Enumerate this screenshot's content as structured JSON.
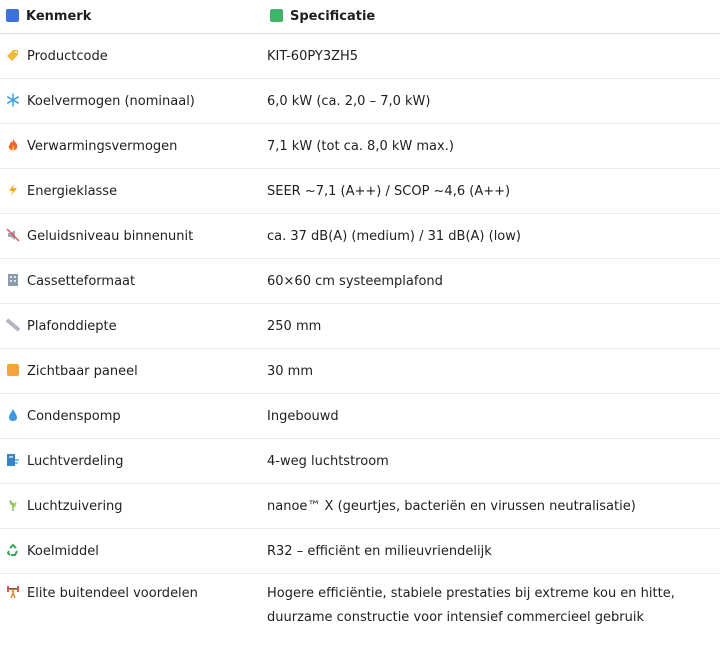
{
  "header": {
    "col1": "Kenmerk",
    "col1_icon": "blue-square-icon",
    "col1_color": "#3b73d9",
    "col2": "Specificatie",
    "col2_icon": "green-square-icon",
    "col2_color": "#3fb56a"
  },
  "rows": [
    {
      "icon": "tag-icon",
      "label": "Productcode",
      "value": "KIT-60PY3ZH5"
    },
    {
      "icon": "snowflake-icon",
      "label": "Koelvermogen (nominaal)",
      "value": "6,0 kW (ca. 2,0 – 7,0 kW)"
    },
    {
      "icon": "fire-icon",
      "label": "Verwarmingsvermogen",
      "value": "7,1 kW (tot ca. 8,0 kW max.)"
    },
    {
      "icon": "lightning-icon",
      "label": "Energieklasse",
      "value": "SEER ~7,1 (A++) / SCOP ~4,6 (A++)"
    },
    {
      "icon": "muted-speaker-icon",
      "label": "Geluidsniveau binnenunit",
      "value": "ca. 37 dB(A) (medium) / 31 dB(A) (low)"
    },
    {
      "icon": "building-icon",
      "label": "Cassetteformaat",
      "value": "60×60 cm systeemplafond"
    },
    {
      "icon": "ruler-icon",
      "label": "Plafonddiepte",
      "value": "250 mm"
    },
    {
      "icon": "orange-square-icon",
      "label": "Zichtbaar paneel",
      "value": "30 mm"
    },
    {
      "icon": "droplet-icon",
      "label": "Condenspomp",
      "value": "Ingebouwd"
    },
    {
      "icon": "wind-building-icon",
      "label": "Luchtverdeling",
      "value": "4-weg luchtstroom"
    },
    {
      "icon": "herb-icon",
      "label": "Luchtzuivering",
      "value": "nanoe™ X (geurtjes, bacteriën en virussen neutralisatie)"
    },
    {
      "icon": "recycle-icon",
      "label": "Koelmiddel",
      "value": "R32 – efficiënt en milieuvriendelijk"
    },
    {
      "icon": "weightlifter-icon",
      "label": "Elite buitendeel voordelen",
      "value": "Hogere efficiëntie, stabiele prestaties bij extreme kou en hitte, duurzame constructie voor intensief commercieel gebruik"
    }
  ]
}
